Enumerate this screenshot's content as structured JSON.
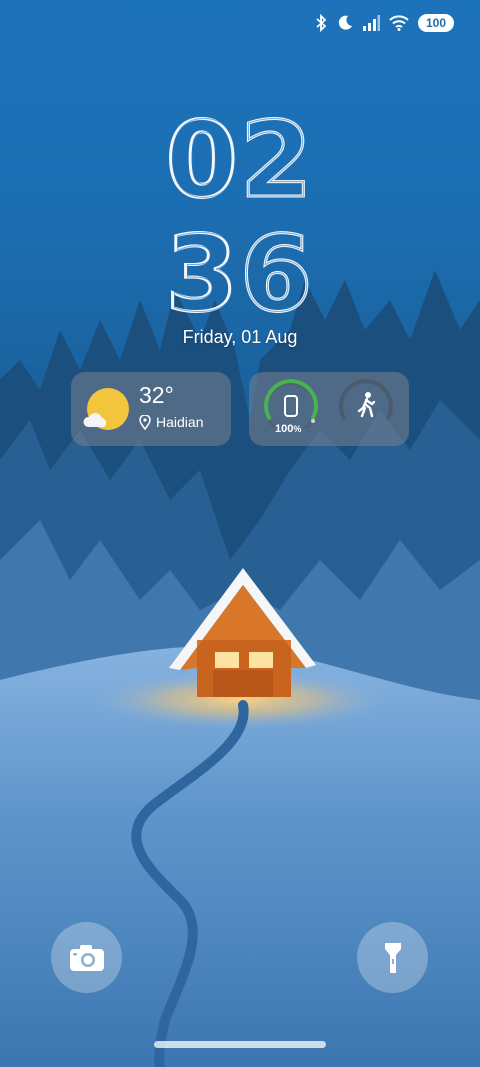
{
  "status_bar": {
    "icons": [
      "bluetooth-icon",
      "moon-icon",
      "signal-icon",
      "wifi-icon"
    ],
    "battery": "100"
  },
  "clock": {
    "hours": "02",
    "minutes": "36"
  },
  "date": "Friday, 01 Aug",
  "weather_widget": {
    "temperature": "32°",
    "location": "Haidian",
    "icon": "partly-sunny-icon",
    "sun_color": "#f3c53c"
  },
  "device_widget": {
    "battery_percent": 100,
    "battery_value": "100",
    "battery_unit": "%",
    "battery_ring_color": "#47b24f",
    "steps_icon": "walking-icon"
  },
  "shortcuts": {
    "left": "camera-icon",
    "right": "flashlight-icon"
  }
}
